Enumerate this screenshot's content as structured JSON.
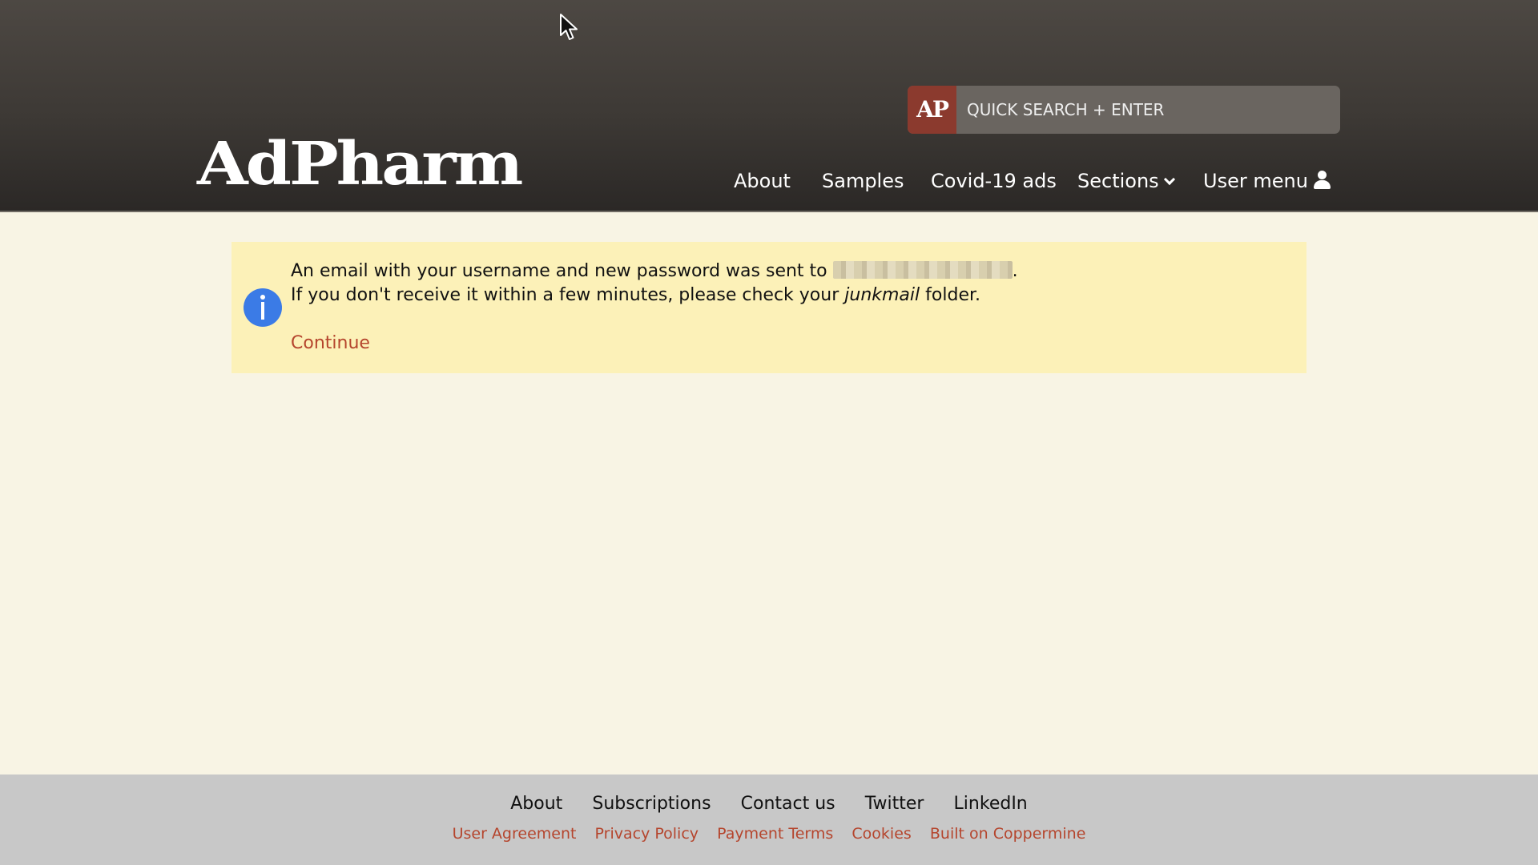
{
  "header": {
    "logo_text": "AdPharm",
    "search": {
      "badge": "AP",
      "placeholder": "QUICK SEARCH + ENTER",
      "value": ""
    },
    "nav": {
      "about": "About",
      "samples": "Samples",
      "covid": "Covid-19 ads",
      "sections": "Sections",
      "user_menu": "User menu"
    }
  },
  "notice": {
    "line1_prefix": "An email with your username and new password was sent to",
    "line1_suffix": ".",
    "line2_prefix": "If you don't receive it within a few minutes, please check your",
    "line2_emphasis": "junkmail",
    "line2_suffix": "folder.",
    "continue_label": "Continue"
  },
  "footer": {
    "primary_links": [
      "About",
      "Subscriptions",
      "Contact us",
      "Twitter",
      "LinkedIn"
    ],
    "secondary_links": [
      "User Agreement",
      "Privacy Policy",
      "Payment Terms",
      "Cookies",
      "Built on Coppermine"
    ]
  },
  "colors": {
    "link_accent": "#b5452d",
    "notice_bg": "#fcf1b8",
    "info_icon": "#3b7be6",
    "page_bg": "#f8f4e4",
    "footer_bg": "#c8c8c8"
  },
  "icons": {
    "info": "info-icon",
    "user": "user-icon",
    "sections_dropdown": "chevron-down-icon",
    "cursor": "mouse-cursor-icon"
  }
}
